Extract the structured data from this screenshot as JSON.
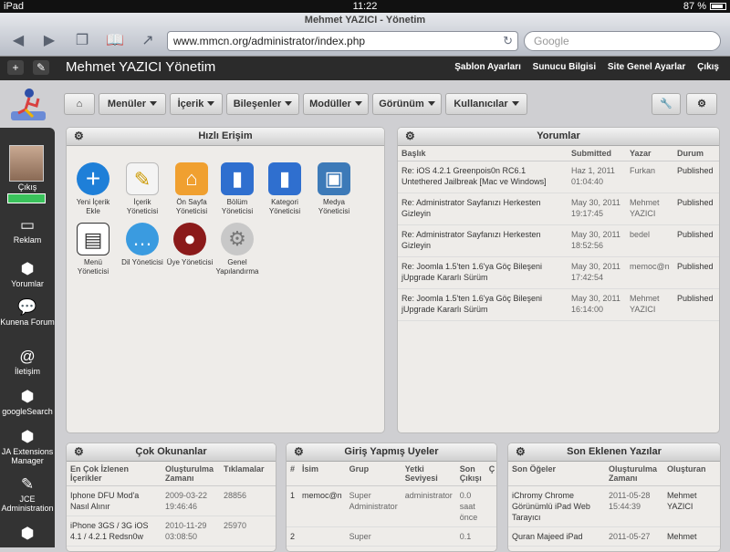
{
  "statusbar": {
    "device": "iPad",
    "time": "11:22",
    "battery": "87 %"
  },
  "browser": {
    "title": "Mehmet YAZICI - Yönetim",
    "url": "www.mmcn.org/administrator/index.php",
    "search_placeholder": "Google"
  },
  "topbar": {
    "brand": "Mehmet YAZICI Yönetim",
    "links": [
      "Şablon Ayarları",
      "Sunucu Bilgisi",
      "Site Genel Ayarlar",
      "Çıkış"
    ]
  },
  "menu": [
    "Menüler",
    "İçerik",
    "Bileşenler",
    "Modüller",
    "Görünüm",
    "Kullanıcılar"
  ],
  "leftbar": {
    "logout": "Çıkış",
    "items": [
      "Reklam",
      "Yorumlar",
      "Kunena Forum",
      "İletişim",
      "googleSearch",
      "JA Extensions Manager",
      "JCE Administration"
    ]
  },
  "quick": {
    "title": "Hızlı Erişim",
    "items": [
      "Yeni İçerik Ekle",
      "İçerik Yöneticisi",
      "Ön Sayfa Yöneticisi",
      "Bölüm Yöneticisi",
      "Kategori Yöneticisi",
      "Medya Yöneticisi",
      "Menü Yöneticisi",
      "Dil Yöneticisi",
      "Üye Yöneticisi",
      "Genel Yapılandırma"
    ]
  },
  "comments": {
    "title": "Yorumlar",
    "headers": [
      "Başlık",
      "Submitted",
      "Yazar",
      "Durum"
    ],
    "rows": [
      {
        "title": "Re: iOS 4.2.1 Greenpois0n RC6.1 Untethered Jailbreak [Mac ve Windows]",
        "date": "Haz 1, 2011 01:04:40",
        "author": "Furkan",
        "status": "Published"
      },
      {
        "title": "Re: Administrator Sayfanızı Herkesten Gizleyin",
        "date": "May 30, 2011 19:17:45",
        "author": "Mehmet YAZICI",
        "status": "Published"
      },
      {
        "title": "Re: Administrator Sayfanızı Herkesten Gizleyin",
        "date": "May 30, 2011 18:52:56",
        "author": "bedel",
        "status": "Published"
      },
      {
        "title": "Re: Joomla 1.5'ten 1.6'ya Göç Bileşeni jUpgrade Kararlı Sürüm",
        "date": "May 30, 2011 17:42:54",
        "author": "memoc@n",
        "status": "Published"
      },
      {
        "title": "Re: Joomla 1.5'ten 1.6'ya Göç Bileşeni jUpgrade Kararlı Sürüm",
        "date": "May 30, 2011 16:14:00",
        "author": "Mehmet YAZICI",
        "status": "Published"
      }
    ]
  },
  "popular": {
    "title": "Çok Okunanlar",
    "headers": [
      "En Çok İzlenen İçerikler",
      "Oluşturulma Zamanı",
      "Tıklamalar"
    ],
    "rows": [
      {
        "title": "Iphone DFU Mod'a Nasıl Alınır",
        "date": "2009-03-22 19:46:46",
        "hits": "28856"
      },
      {
        "title": "iPhone 3GS / 3G iOS 4.1 / 4.2.1 Redsn0w",
        "date": "2010-11-29 03:08:50",
        "hits": "25970"
      }
    ]
  },
  "logged": {
    "title": "Giriş Yapmış Uyeler",
    "headers": [
      "#",
      "İsim",
      "Grup",
      "Yetki Seviyesi",
      "Son Çıkışı",
      "Ç"
    ],
    "rows": [
      {
        "n": "1",
        "name": "memoc@n",
        "group": "Super Administrator",
        "level": "administrator",
        "last": "0.0 saat önce"
      },
      {
        "n": "2",
        "name": "",
        "group": "Super",
        "level": "",
        "last": "0.1"
      }
    ]
  },
  "recent": {
    "title": "Son Eklenen Yazılar",
    "headers": [
      "Son Öğeler",
      "Oluşturulma Zamanı",
      "Oluşturan"
    ],
    "rows": [
      {
        "title": "iChromy Chrome Görünümlü iPad Web Tarayıcı",
        "date": "2011-05-28 15:44:39",
        "author": "Mehmet YAZICI"
      },
      {
        "title": "Quran Majeed iPad",
        "date": "2011-05-27",
        "author": "Mehmet"
      }
    ]
  }
}
